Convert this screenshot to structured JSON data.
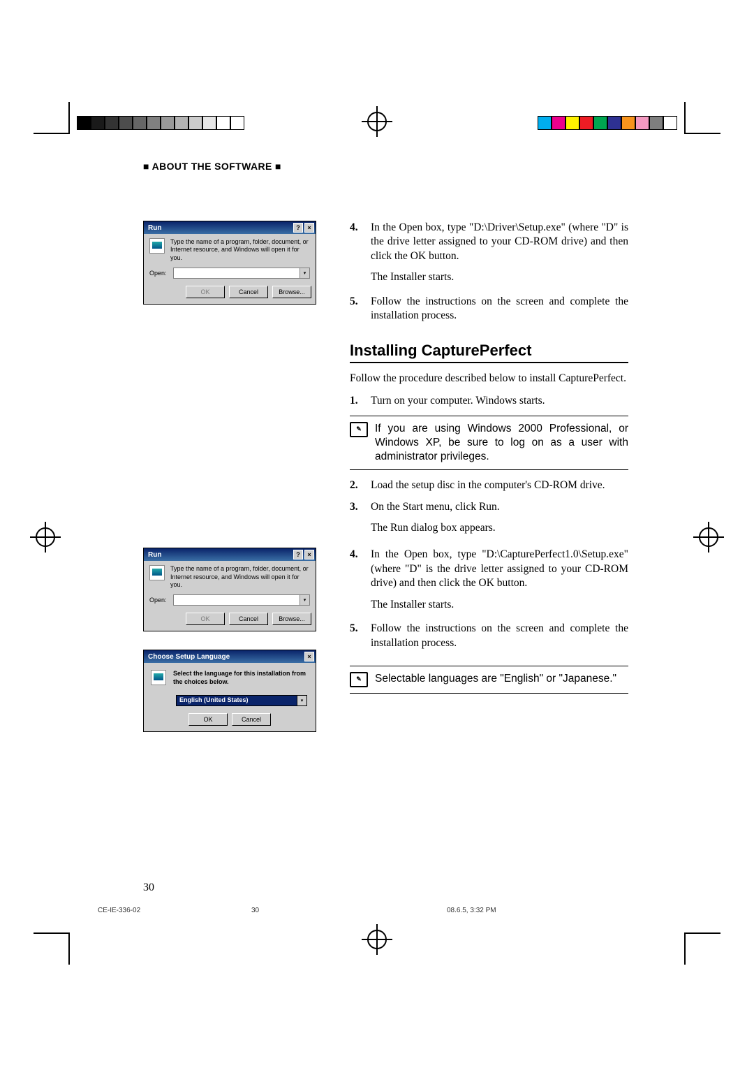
{
  "header": {
    "section_title": "■ ABOUT THE SOFTWARE ■"
  },
  "steps_a": {
    "s4": {
      "num": "4.",
      "txt": "In the Open box, type \"D:\\Driver\\Setup.exe\" (where \"D\" is the drive letter assigned to your CD-ROM drive) and then click the OK button."
    },
    "s4b": "The Installer starts.",
    "s5": {
      "num": "5.",
      "txt": "Follow the instructions on the screen and complete the installation process."
    }
  },
  "subheading": "Installing CapturePerfect",
  "intro": "Follow the procedure described below to install CapturePerfect.",
  "steps_b": {
    "s1": {
      "num": "1.",
      "txt": "Turn on your computer. Windows starts."
    },
    "note1": "If you are using Windows 2000 Professional, or Windows XP, be sure to log on as a user with administrator privileges.",
    "s2": {
      "num": "2.",
      "txt": "Load the setup disc in the computer's CD-ROM drive."
    },
    "s3": {
      "num": "3.",
      "txt": "On the Start menu, click Run."
    },
    "s3b": "The Run dialog box appears.",
    "s4": {
      "num": "4.",
      "txt": "In the Open box, type \"D:\\CapturePerfect1.0\\Setup.exe\" (where \"D\" is the drive letter assigned to your CD-ROM drive) and then click the OK button."
    },
    "s4b": "The Installer starts.",
    "s5": {
      "num": "5.",
      "txt": "Follow the instructions on the screen and complete the installation process."
    },
    "note2": "Selectable languages are \"English\" or \"Japanese.\""
  },
  "run_dialog": {
    "title": "Run",
    "desc": "Type the name of a program, folder, document, or Internet resource, and Windows will open it for you.",
    "open_label": "Open:",
    "ok": "OK",
    "cancel": "Cancel",
    "browse": "Browse..."
  },
  "lang_dialog": {
    "title": "Choose Setup Language",
    "desc": "Select the language for this installation from the choices below.",
    "value": "English (United States)",
    "ok": "OK",
    "cancel": "Cancel"
  },
  "page_number": "30",
  "footer": {
    "code": "CE-IE-336-02",
    "page": "30",
    "stamp": "08.6.5, 3:32 PM"
  },
  "colors": {
    "grays": [
      "#000",
      "#1a1a1a",
      "#333",
      "#4d4d4d",
      "#666",
      "#808080",
      "#999",
      "#b3b3b3",
      "#ccc",
      "#e6e6e6",
      "#fff",
      "#fff"
    ],
    "colors": [
      "#00aeef",
      "#ec008c",
      "#fff200",
      "#ed1c24",
      "#00a651",
      "#2e3192",
      "#f7941d",
      "#f49ac1",
      "#7f7f7f",
      "#fff"
    ]
  }
}
